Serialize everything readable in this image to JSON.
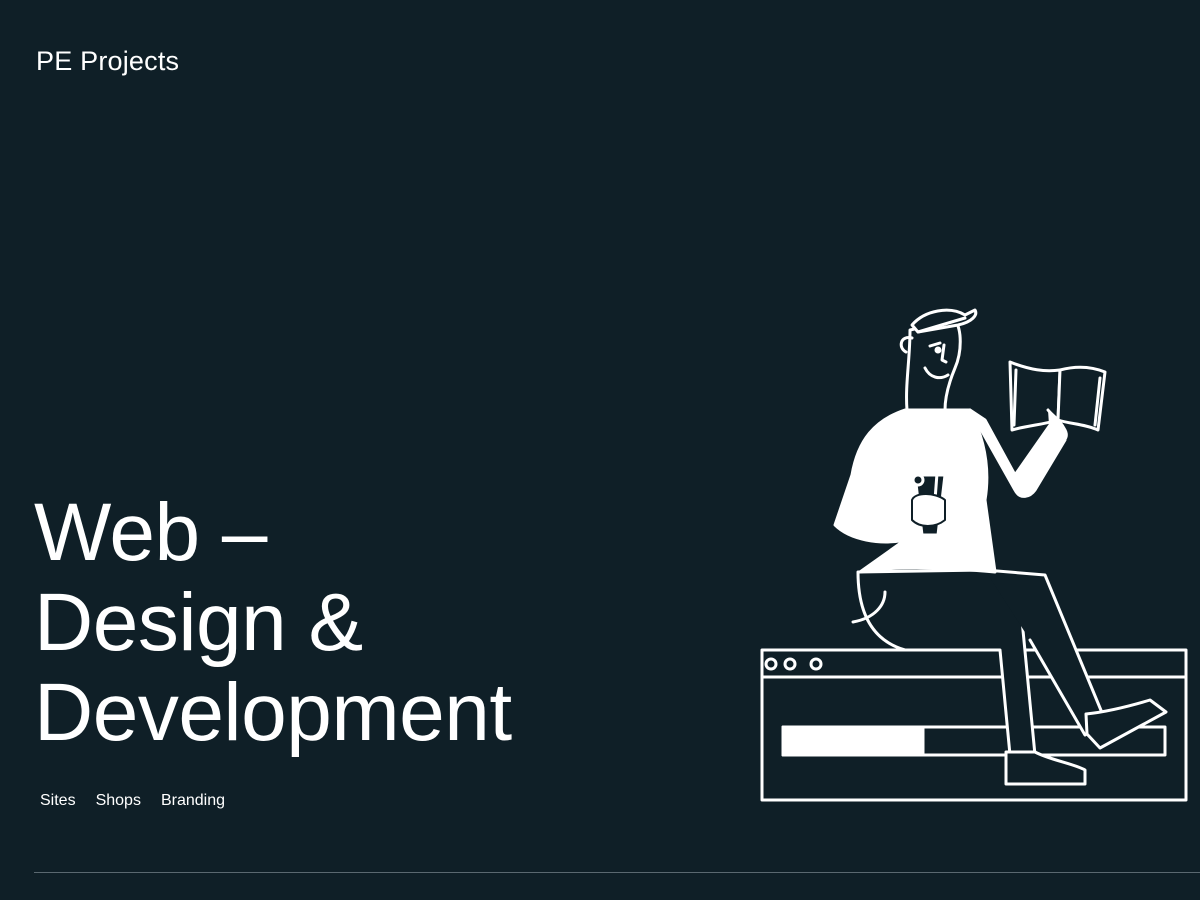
{
  "header": {
    "brand": "PE Projects"
  },
  "hero": {
    "title_lines": [
      "Web –",
      "Design &",
      "Development"
    ]
  },
  "tags": [
    {
      "label": "Sites"
    },
    {
      "label": "Shops"
    },
    {
      "label": "Branding"
    }
  ],
  "colors": {
    "background": "#0f1f27",
    "foreground": "#ffffff",
    "divider": "#5a6870"
  },
  "illustration": {
    "icon": "person-reading-on-browser-window-illustration"
  }
}
